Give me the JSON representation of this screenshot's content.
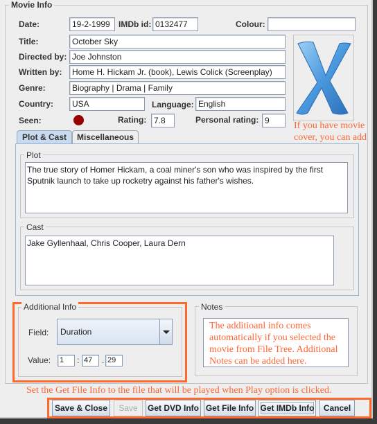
{
  "movie_info": {
    "group_title": "Movie Info",
    "date": {
      "label": "Date:",
      "value": "19-2-1999"
    },
    "imdb_id": {
      "label": "IMDb id:",
      "value": "0132477"
    },
    "colour": {
      "label": "Colour:",
      "value": ""
    },
    "title": {
      "label": "Title:",
      "value": "October Sky"
    },
    "directed_by": {
      "label": "Directed by:",
      "value": "Joe Johnston"
    },
    "written_by": {
      "label": "Written by:",
      "value": "Home H. Hickam Jr. (book), Lewis Colick (Screenplay)"
    },
    "genre": {
      "label": "Genre:",
      "value": "Biography | Drama | Family"
    },
    "country": {
      "label": "Country:",
      "value": "USA"
    },
    "language": {
      "label": "Language:",
      "value": "English"
    },
    "seen": {
      "label": "Seen:",
      "state": "seen",
      "color": "#990000"
    },
    "rating": {
      "label": "Rating:",
      "value": "7.8"
    },
    "personal_rating": {
      "label": "Personal rating:",
      "value": "9"
    },
    "cover": {
      "icon": "mac-os-x-cover-icon",
      "glyph": "X",
      "annotation": "If you have movie cover, you can add that too."
    }
  },
  "tabs": [
    {
      "label": "Plot & Cast",
      "active": true
    },
    {
      "label": "Miscellaneous",
      "active": false
    }
  ],
  "plot": {
    "title": "Plot",
    "text": "The true story of Homer Hickam, a coal miner's son who was inspired by the first Sputnik launch to take up rocketry against his father's wishes."
  },
  "cast": {
    "title": "Cast",
    "text": "Jake Gyllenhaal, Chris Cooper, Laura Dern"
  },
  "additional_info": {
    "title": "Additional Info",
    "field_label": "Field:",
    "field_value": "Duration",
    "value_label": "Value:",
    "hours": "1",
    "sep1": ":",
    "minutes": "47",
    "sep2": ".",
    "seconds": "29"
  },
  "notes": {
    "title": "Notes",
    "text": "The additioanl info comes automatically if you selected the movie from File Tree. Additional Notes can be added here."
  },
  "annotation_bottom": "Set the Get File Info to the file that will be played when Play option is clicked.",
  "buttons": {
    "save_close": "Save & Close",
    "save": "Save",
    "get_dvd_info": "Get DVD Info",
    "get_file_info": "Get File Info",
    "get_imdb_info": "Get IMDb Info",
    "cancel": "Cancel"
  },
  "colors": {
    "annotation": "#ff6633",
    "highlight": "#ff6a2b",
    "tab_active": "#c8daf0"
  }
}
